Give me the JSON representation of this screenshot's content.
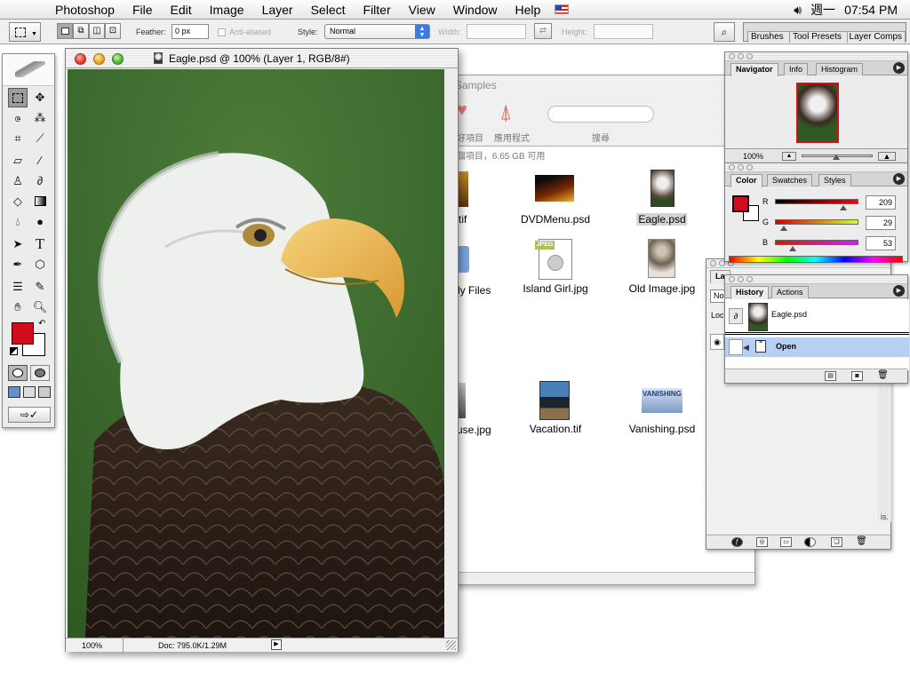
{
  "menubar": {
    "items": [
      "Photoshop",
      "File",
      "Edit",
      "Image",
      "Layer",
      "Select",
      "Filter",
      "View",
      "Window",
      "Help"
    ],
    "clock_day": "週一",
    "clock_time": "07:54 PM"
  },
  "options": {
    "feather_label": "Feather:",
    "feather_value": "0 px",
    "antialias_label": "Anti-aliased",
    "style_label": "Style:",
    "style_value": "Normal",
    "width_label": "Width:",
    "height_label": "Height:"
  },
  "palette_well": {
    "tabs": [
      "Brushes",
      "Tool Presets",
      "Layer Comps"
    ]
  },
  "finder": {
    "title": "Samples",
    "toolbar_items": [
      "喜好項目",
      "應用程式",
      "搜尋"
    ],
    "status": "16 個項目，6.65 GB 可用",
    "items": [
      {
        "name": "DVDMenu.psd"
      },
      {
        "name": "Eagle.psd"
      },
      {
        "name": "Island Girl.jpg"
      },
      {
        "name": "Old Image.jpg"
      },
      {
        "name": "Vacation.tif"
      },
      {
        "name": "Vanishing.psd"
      }
    ],
    "cut_labels": [
      "tif",
      "dy Files",
      "use.jpg"
    ],
    "vanishing_thumb_text": "VANISHING"
  },
  "document": {
    "title": "Eagle.psd @ 100% (Layer 1, RGB/8#)",
    "zoom": "100%",
    "doc_size": "Doc: 795.0K/1.29M"
  },
  "navigator": {
    "tabs": [
      "Navigator",
      "Info",
      "Histogram"
    ],
    "zoom": "100%"
  },
  "color": {
    "tabs": [
      "Color",
      "Swatches",
      "Styles"
    ],
    "foreground": "#d10d1d",
    "channels": [
      {
        "label": "R",
        "value": "209",
        "fraction": 0.82
      },
      {
        "label": "G",
        "value": "29",
        "fraction": 0.11
      },
      {
        "label": "B",
        "value": "53",
        "fraction": 0.21
      }
    ]
  },
  "layers": {
    "tab_partial": "La",
    "row_partial_1": "No",
    "row_partial_2": "Loc"
  },
  "history": {
    "tabs": [
      "History",
      "Actions"
    ],
    "snapshot": "Eagle.psd",
    "state": "Open"
  },
  "colors": {
    "accent_blue": "#3d7be0",
    "selection_blue": "#b5d0f2",
    "eagle_bg": "#3f6e30"
  }
}
